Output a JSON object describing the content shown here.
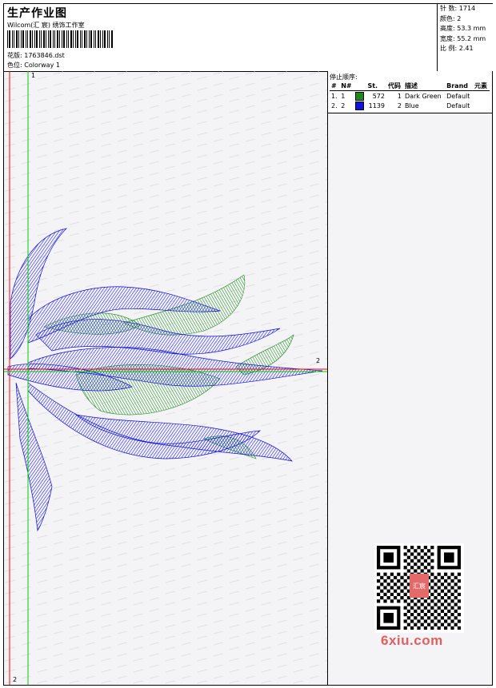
{
  "header": {
    "title": "生产作业图",
    "company": "Wilcom(汇 宸) 绣饰工作室",
    "design_label": "花版: 1763846.dst",
    "colorway_label": "色位: Colorway 1"
  },
  "stats": {
    "stitches": "针 数: 1714",
    "colors": "颜色: 2",
    "height": "高度: 53.3 mm",
    "width": "宽度: 55.2 mm",
    "ratio": "比 例: 2.41"
  },
  "stop_sequence": {
    "title": "停止顺序:",
    "headers": [
      "#",
      "N#",
      "St.",
      "代码",
      "描述",
      "Brand",
      "元素"
    ],
    "rows": [
      {
        "index": "1.",
        "needle": "1",
        "color": "#1a8a1a",
        "stitches": "572",
        "code": "1",
        "description": "Dark Green",
        "brand": "Default"
      },
      {
        "index": "2.",
        "needle": "2",
        "color": "#1010e0",
        "stitches": "1139",
        "code": "2",
        "description": "Blue",
        "brand": "Default"
      }
    ]
  },
  "axes": {
    "v_top": "1",
    "v_bottom": "2",
    "h_right": "2"
  },
  "watermark": {
    "brand": "6xiu.com",
    "seal": "汇宸"
  }
}
